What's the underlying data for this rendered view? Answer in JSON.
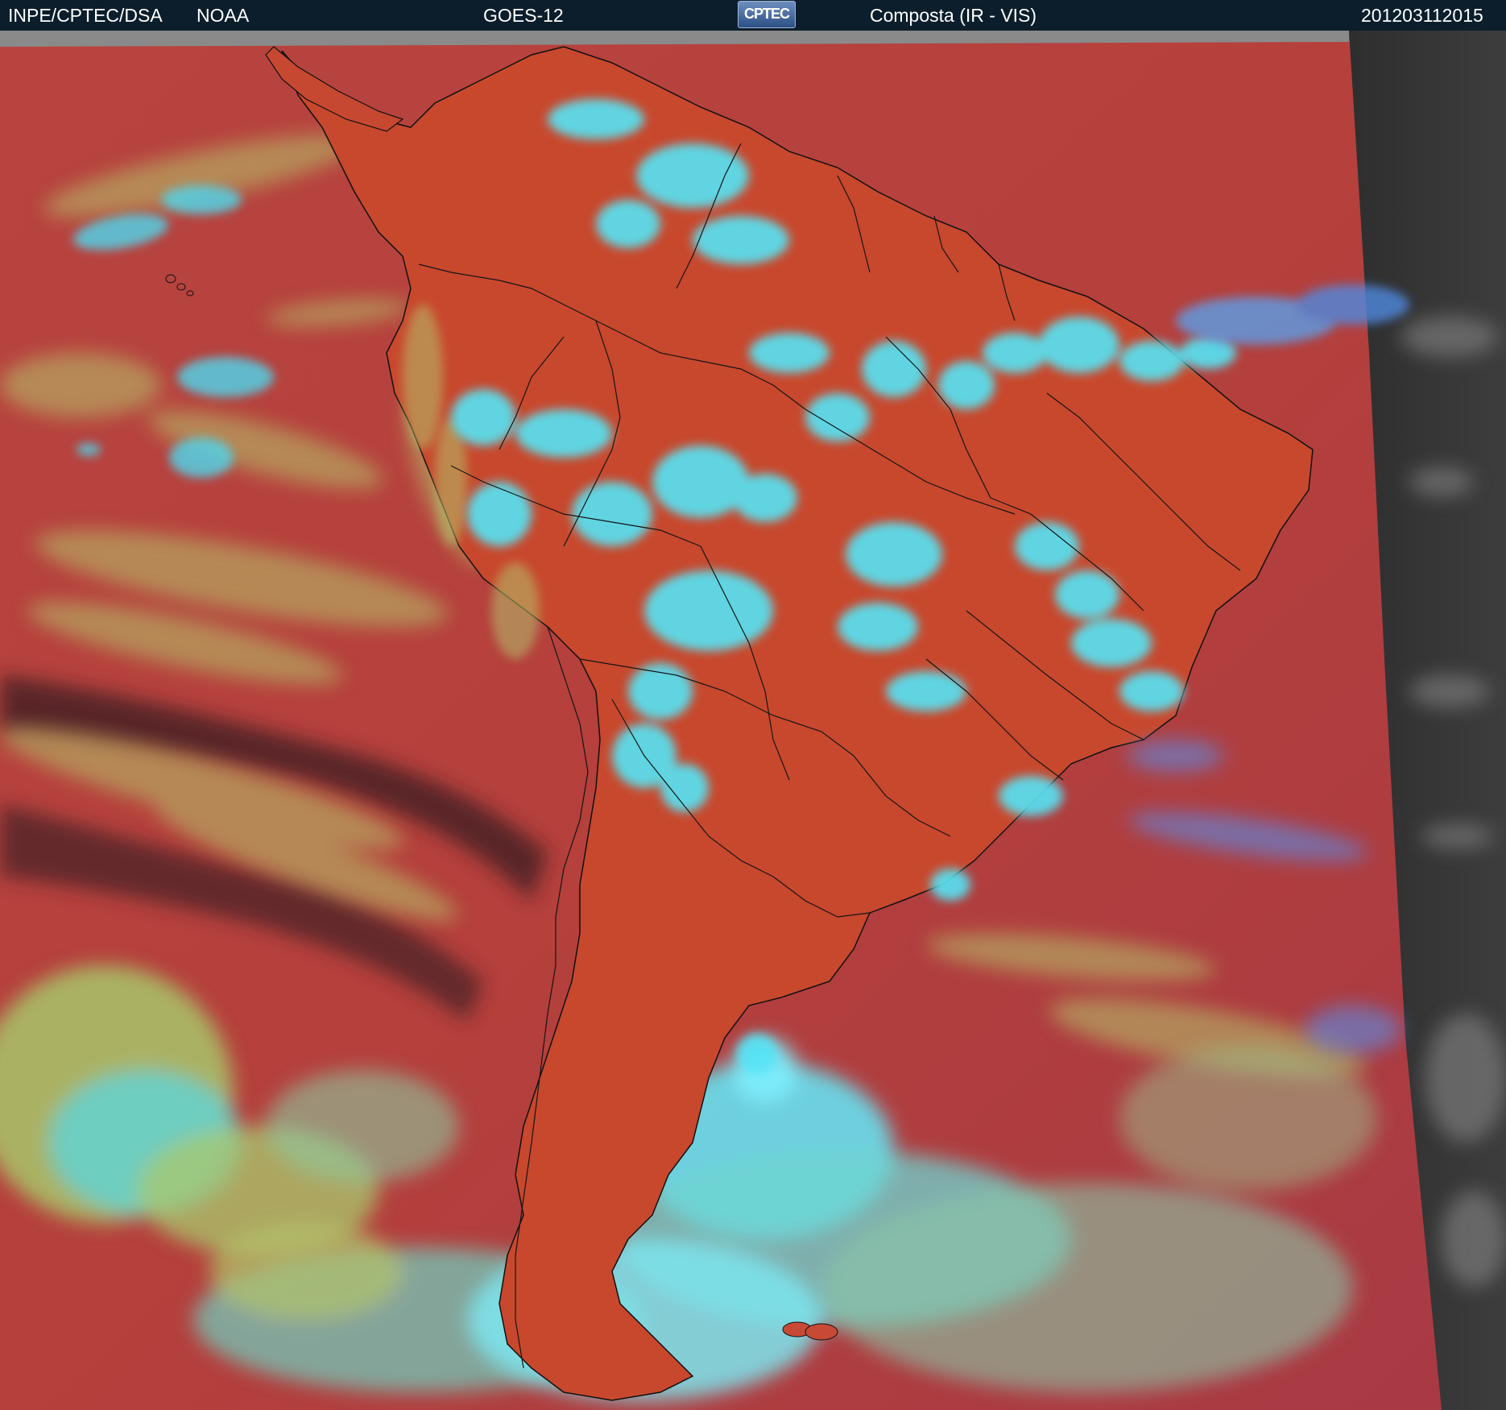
{
  "header": {
    "org": "INPE/CPTEC/DSA",
    "agency": "NOAA",
    "satellite": "GOES-12",
    "logo_text": "CPTEC",
    "product": "Composta (IR - VIS)",
    "timestamp": "201203112015"
  },
  "colors": {
    "header_bg": "#0c1e2b",
    "clear_ocean": "#b5413f",
    "clear_land": "#c8482c",
    "high_cloud": "#4fe3f0",
    "low_cloud": "#b7c56a",
    "outside_vis_swath": "#3a3a3a",
    "outline": "#111111"
  }
}
